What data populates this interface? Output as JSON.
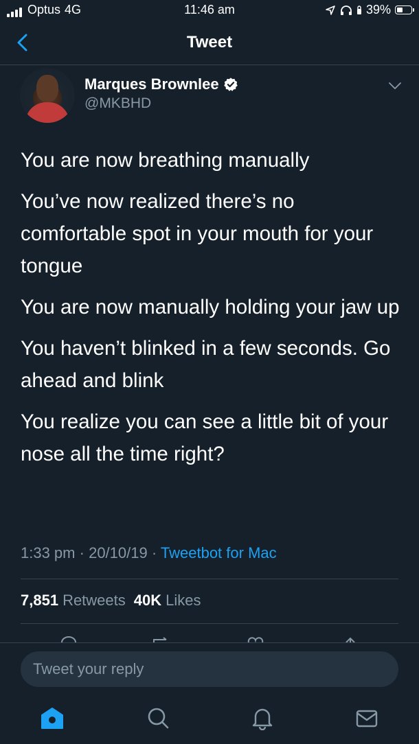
{
  "status_bar": {
    "carrier": "Optus",
    "network": "4G",
    "time": "11:46 am",
    "battery": "39%"
  },
  "nav": {
    "title": "Tweet"
  },
  "author": {
    "name": "Marques Brownlee",
    "handle": "@MKBHD"
  },
  "tweet": {
    "lines": [
      "You are now breathing manually",
      "You’ve now realized there’s no comfortable spot in your mouth for your tongue",
      "You are now manually holding your jaw up",
      "You haven’t blinked in a few seconds. Go ahead and blink",
      "You realize you can see a little bit of your nose all the time right?"
    ]
  },
  "meta": {
    "time": "1:33 pm",
    "date": "20/10/19",
    "separator": "·",
    "client": "Tweetbot for Mac"
  },
  "stats": {
    "retweets_count": "7,851",
    "retweets_label": "Retweets",
    "likes_count": "40K",
    "likes_label": "Likes"
  },
  "reply": {
    "placeholder": "Tweet your reply"
  },
  "colors": {
    "background": "#15202b",
    "accent": "#1da1f2",
    "secondary_text": "#8899a6",
    "divider": "#38444d"
  },
  "icons": {
    "back": "chevron-left-icon",
    "verified": "verified-badge-icon",
    "more": "chevron-down-icon",
    "tabs": [
      "home-icon",
      "search-icon",
      "notifications-icon",
      "messages-icon"
    ]
  }
}
